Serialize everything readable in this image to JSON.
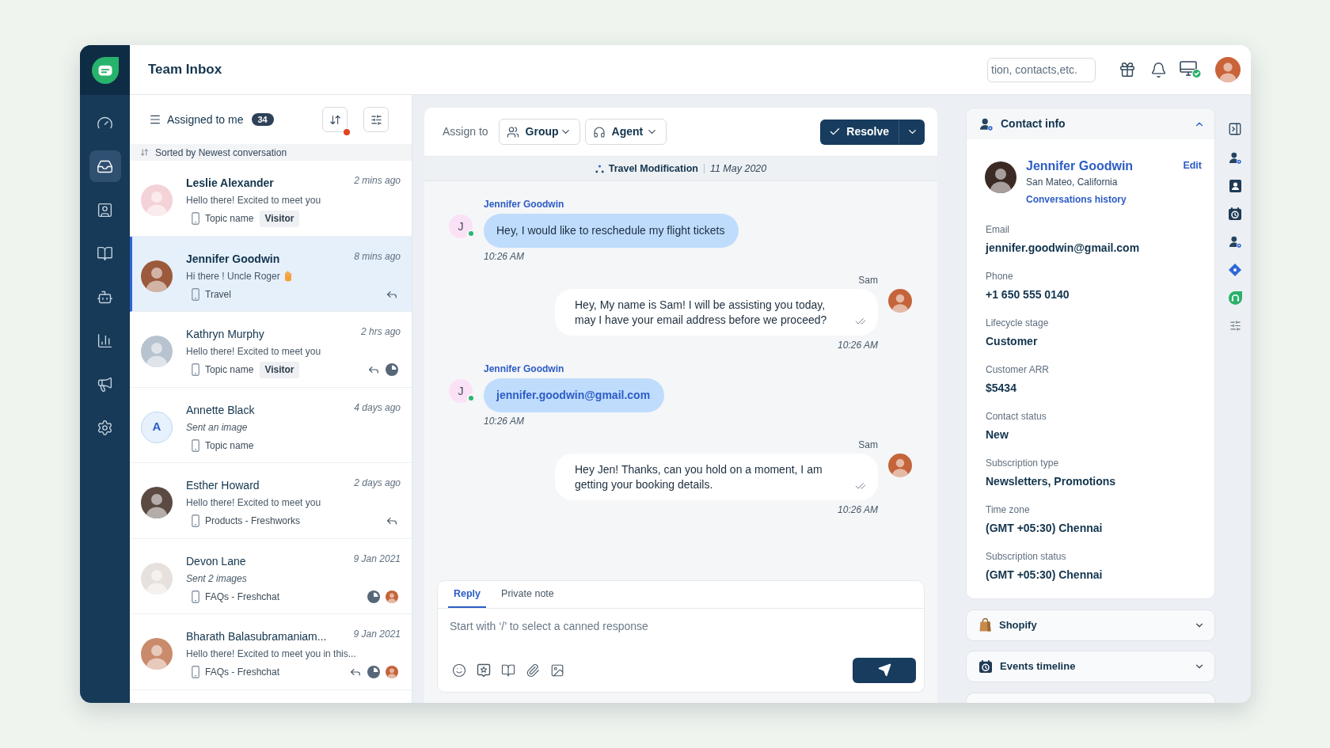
{
  "nav": {
    "items": [
      {
        "selected": false
      },
      {
        "selected": true
      },
      {
        "selected": false
      },
      {
        "selected": false
      },
      {
        "selected": false
      },
      {
        "selected": false
      },
      {
        "selected": false
      },
      {
        "selected": false
      }
    ]
  },
  "header": {
    "title": "Team Inbox",
    "search": {
      "placeholder": "tion, contacts,etc."
    }
  },
  "conversation_list": {
    "view": {
      "label": "Assigned to me",
      "count": "34"
    },
    "sort_alert": true,
    "sort_note": "Sorted by Newest conversation",
    "conversations": [
      {
        "name": "Leslie Alexander",
        "time": "2 mins ago",
        "preview": "Hello there! Excited to meet you",
        "attachment": false,
        "has_emoji": false,
        "topic": "Topic name",
        "tag": "Visitor",
        "unread": true,
        "selected": false,
        "replied": false,
        "snoozed": false,
        "agent_avatar": false,
        "avatar": {
          "kind": "photo"
        }
      },
      {
        "name": "Jennifer Goodwin",
        "time": "8 mins ago",
        "preview": "Hi there ! Uncle Roger",
        "attachment": false,
        "has_emoji": true,
        "topic": "Travel",
        "unread": true,
        "selected": true,
        "replied": true,
        "snoozed": false,
        "agent_avatar": false,
        "avatar": {
          "kind": "photo"
        }
      },
      {
        "name": "Kathryn Murphy",
        "time": "2 hrs ago",
        "preview": "Hello there! Excited to meet you",
        "attachment": false,
        "has_emoji": false,
        "topic": "Topic name",
        "tag": "Visitor",
        "unread": false,
        "selected": false,
        "replied": true,
        "snoozed": true,
        "agent_avatar": false,
        "avatar": {
          "kind": "photo"
        }
      },
      {
        "name": "Annette Black",
        "time": "4 days ago",
        "preview": "Sent an image",
        "attachment": true,
        "has_emoji": false,
        "topic": "Topic name",
        "unread": false,
        "selected": false,
        "replied": false,
        "snoozed": false,
        "agent_avatar": false,
        "avatar": {
          "kind": "initial",
          "initial": "A"
        }
      },
      {
        "name": "Esther Howard",
        "time": "2 days ago",
        "preview": "Hello there! Excited to meet you",
        "attachment": false,
        "has_emoji": false,
        "topic": "Products - Freshworks",
        "unread": false,
        "selected": false,
        "replied": true,
        "snoozed": false,
        "agent_avatar": false,
        "avatar": {
          "kind": "photo"
        }
      },
      {
        "name": "Devon Lane",
        "time": "9 Jan 2021",
        "preview": "Sent 2 images",
        "attachment": true,
        "has_emoji": false,
        "topic": "FAQs - Freshchat",
        "unread": false,
        "selected": false,
        "replied": false,
        "snoozed": true,
        "agent_avatar": true,
        "avatar": {
          "kind": "photo"
        }
      },
      {
        "name": "Bharath Balasubramaniam...",
        "time": "9 Jan 2021",
        "preview": "Hello there! Excited to meet you in this...",
        "attachment": false,
        "has_emoji": false,
        "topic": "FAQs - Freshchat",
        "unread": false,
        "selected": false,
        "replied": true,
        "snoozed": true,
        "agent_avatar": true,
        "avatar": {
          "kind": "photo"
        }
      }
    ]
  },
  "chat": {
    "assign_label": "Assign to",
    "group": "Group",
    "agent": "Agent",
    "resolve": "Resolve",
    "topic": "Travel Modification",
    "date": "11 May 2020",
    "messages": [
      {
        "kind": "incoming",
        "author": "Jennifer Goodwin",
        "avatar_initial": "J",
        "online": true,
        "text": "Hey, I would like to reschedule my flight tickets",
        "link": false,
        "read": false,
        "time": "10:26 AM"
      },
      {
        "kind": "outgoing",
        "author": "Sam",
        "online": false,
        "text": "Hey, My name is Sam! I will be assisting you today, may I have your email address before we proceed?",
        "link": false,
        "read": true,
        "time": "10:26 AM"
      },
      {
        "kind": "incoming",
        "author": "Jennifer Goodwin",
        "avatar_initial": "J",
        "online": true,
        "text": "jennifer.goodwin@gmail.com",
        "link": true,
        "read": false,
        "time": "10:26 AM"
      },
      {
        "kind": "outgoing",
        "author": "Sam",
        "online": false,
        "text": "Hey Jen! Thanks, can you hold on a moment, I am getting your booking details.",
        "link": false,
        "read": true,
        "time": "10:26 AM"
      }
    ],
    "composer": {
      "tabs": [
        {
          "label": "Reply",
          "selected": true
        },
        {
          "label": "Private note",
          "selected": false
        }
      ],
      "placeholder": "Start with ‘/’ to select a canned response"
    }
  },
  "contact_panel": {
    "title": "Contact info",
    "expanded": true,
    "name": "Jennifer Goodwin",
    "edit": "Edit",
    "location": "San Mateo, California",
    "history_link": "Conversations history",
    "fields": [
      {
        "label": "Email",
        "value": "jennifer.goodwin@gmail.com"
      },
      {
        "label": "Phone",
        "value": "+1 650 555 0140"
      },
      {
        "label": "Lifecycle stage",
        "value": "Customer"
      },
      {
        "label": "Customer ARR",
        "value": "$5434"
      },
      {
        "label": "Contact status",
        "value": "New"
      },
      {
        "label": "Subscription type",
        "value": "Newsletters, Promotions"
      },
      {
        "label": "Time zone",
        "value": "(GMT +05:30) Chennai"
      },
      {
        "label": "Subscription status",
        "value": "(GMT +05:30) Chennai"
      }
    ]
  },
  "sections": [
    {
      "title": "Shopify",
      "expanded": false
    },
    {
      "title": "Events timeline",
      "expanded": false
    }
  ]
}
